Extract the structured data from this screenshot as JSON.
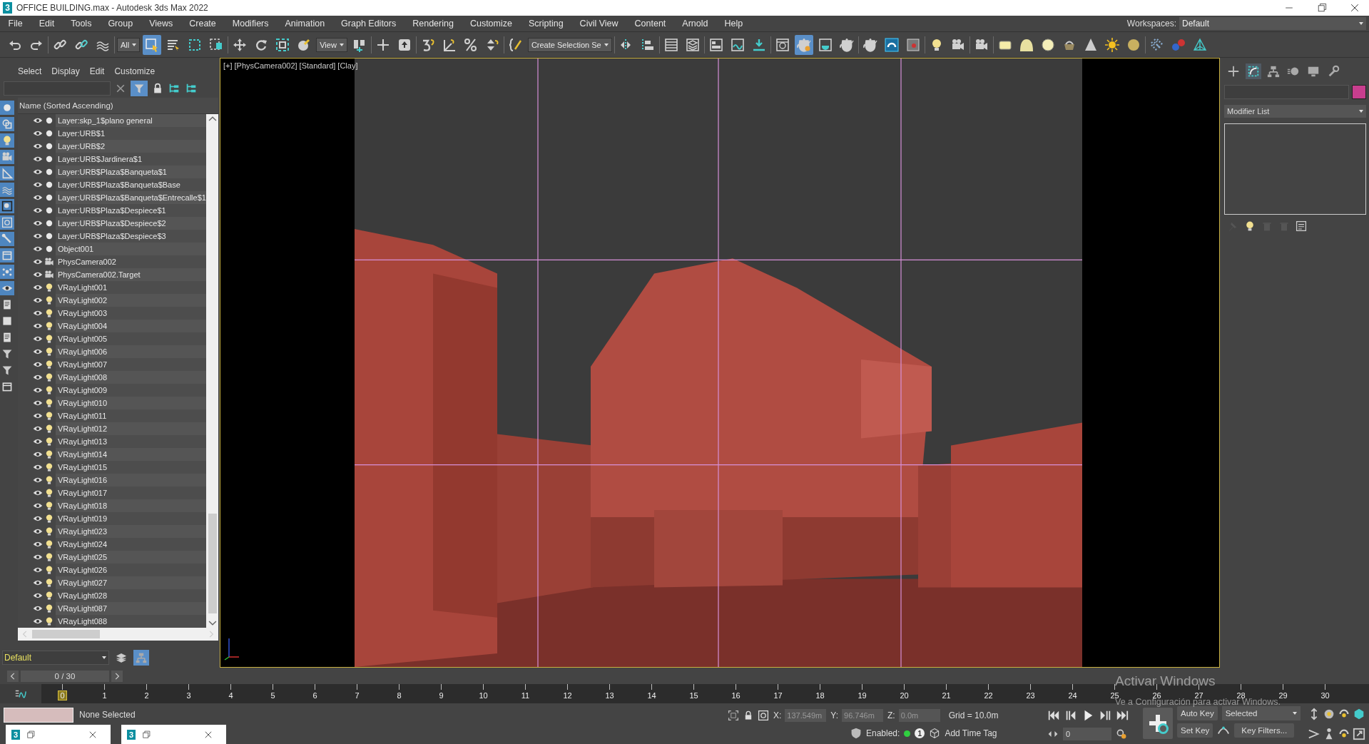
{
  "window": {
    "icon_label": "3",
    "title": "OFFICE BUILDING.max - Autodesk 3ds Max 2022"
  },
  "menu": [
    "File",
    "Edit",
    "Tools",
    "Group",
    "Views",
    "Create",
    "Modifiers",
    "Animation",
    "Graph Editors",
    "Rendering",
    "Customize",
    "Scripting",
    "Civil View",
    "Content",
    "Arnold",
    "Help"
  ],
  "workspaces": {
    "label": "Workspaces:",
    "value": "Default"
  },
  "toolbar": {
    "groups": [
      {
        "items": [
          {
            "kind": "icon",
            "selected": false
          },
          {
            "kind": "icon",
            "selected": false
          }
        ]
      },
      {
        "items": [
          {
            "kind": "icon",
            "selected": false
          },
          {
            "kind": "icon",
            "selected": false
          },
          {
            "kind": "icon",
            "selected": false
          }
        ]
      },
      {
        "items": [
          {
            "kind": "dropdown",
            "value": "All"
          },
          {
            "kind": "icon",
            "selected": true
          },
          {
            "kind": "icon",
            "selected": false
          },
          {
            "kind": "icon",
            "selected": false
          },
          {
            "kind": "icon",
            "selected": false
          }
        ]
      },
      {
        "items": [
          {
            "kind": "icon",
            "selected": false
          },
          {
            "kind": "icon",
            "selected": false
          },
          {
            "kind": "icon",
            "selected": false
          },
          {
            "kind": "icon",
            "selected": false
          },
          {
            "kind": "dropdown",
            "value": "View"
          },
          {
            "kind": "icon",
            "selected": false
          }
        ]
      },
      {
        "items": [
          {
            "kind": "icon",
            "selected": false
          },
          {
            "kind": "icon",
            "selected": false
          }
        ]
      },
      {
        "items": [
          {
            "kind": "icon",
            "selected": false
          },
          {
            "kind": "icon",
            "selected": false
          },
          {
            "kind": "icon",
            "selected": false
          },
          {
            "kind": "icon",
            "selected": false
          }
        ]
      },
      {
        "items": [
          {
            "kind": "icon",
            "selected": false
          },
          {
            "kind": "dropdown",
            "value": "Create Selection Se"
          }
        ]
      },
      {
        "items": [
          {
            "kind": "icon",
            "selected": false
          },
          {
            "kind": "icon",
            "selected": false
          }
        ]
      },
      {
        "items": [
          {
            "kind": "icon",
            "selected": false
          },
          {
            "kind": "icon",
            "selected": false
          }
        ]
      },
      {
        "items": [
          {
            "kind": "icon",
            "selected": false
          },
          {
            "kind": "icon",
            "selected": false
          },
          {
            "kind": "icon",
            "selected": false
          }
        ]
      },
      {
        "items": [
          {
            "kind": "icon",
            "selected": false
          },
          {
            "kind": "icon",
            "selected": true
          },
          {
            "kind": "icon",
            "selected": false
          },
          {
            "kind": "icon",
            "selected": false
          }
        ]
      },
      {
        "items": [
          {
            "kind": "icon",
            "selected": false
          },
          {
            "kind": "icon",
            "selected": false
          },
          {
            "kind": "icon",
            "selected": false
          }
        ]
      },
      {
        "items": [
          {
            "kind": "icon",
            "selected": false
          },
          {
            "kind": "icon",
            "selected": false
          }
        ]
      },
      {
        "items": [
          {
            "kind": "icon",
            "selected": false
          }
        ]
      },
      {
        "items": [
          {
            "kind": "icon",
            "selected": false
          },
          {
            "kind": "icon",
            "selected": false
          },
          {
            "kind": "icon",
            "selected": false
          },
          {
            "kind": "icon",
            "selected": false
          },
          {
            "kind": "icon",
            "selected": false
          },
          {
            "kind": "icon",
            "selected": false
          },
          {
            "kind": "icon",
            "selected": false
          }
        ]
      },
      {
        "items": [
          {
            "kind": "icon",
            "selected": false
          },
          {
            "kind": "icon",
            "selected": false
          },
          {
            "kind": "icon",
            "selected": false
          }
        ]
      }
    ]
  },
  "left_strip": [
    {
      "selected": true
    },
    {
      "selected": true
    },
    {
      "selected": true
    },
    {
      "selected": true
    },
    {
      "selected": true
    },
    {
      "selected": true
    },
    {
      "selected": true
    },
    {
      "selected": true
    },
    {
      "selected": true
    },
    {
      "selected": true
    },
    {
      "selected": true
    },
    {
      "selected": true
    },
    {
      "selected": false
    },
    {
      "selected": false
    },
    {
      "selected": false
    },
    {
      "selected": false
    },
    {
      "selected": false
    },
    {
      "selected": false
    }
  ],
  "scene_explorer": {
    "menu": [
      "Select",
      "Display",
      "Edit",
      "Customize"
    ],
    "column": "Name (Sorted Ascending)",
    "rows": [
      {
        "kind": "layer",
        "name": "Layer:skp_1$plano general"
      },
      {
        "kind": "layer",
        "name": "Layer:URB$1"
      },
      {
        "kind": "layer",
        "name": "Layer:URB$2"
      },
      {
        "kind": "layer",
        "name": "Layer:URB$Jardinera$1"
      },
      {
        "kind": "layer",
        "name": "Layer:URB$Plaza$Banqueta$1"
      },
      {
        "kind": "layer",
        "name": "Layer:URB$Plaza$Banqueta$Base"
      },
      {
        "kind": "layer",
        "name": "Layer:URB$Plaza$Banqueta$Entrecalle$1"
      },
      {
        "kind": "layer",
        "name": "Layer:URB$Plaza$Despiece$1"
      },
      {
        "kind": "layer",
        "name": "Layer:URB$Plaza$Despiece$2"
      },
      {
        "kind": "layer",
        "name": "Layer:URB$Plaza$Despiece$3"
      },
      {
        "kind": "layer",
        "name": "Object001"
      },
      {
        "kind": "camera",
        "name": "PhysCamera002"
      },
      {
        "kind": "camera",
        "name": "PhysCamera002.Target"
      },
      {
        "kind": "light",
        "name": "VRayLight001"
      },
      {
        "kind": "light",
        "name": "VRayLight002"
      },
      {
        "kind": "light",
        "name": "VRayLight003"
      },
      {
        "kind": "light",
        "name": "VRayLight004"
      },
      {
        "kind": "light",
        "name": "VRayLight005"
      },
      {
        "kind": "light",
        "name": "VRayLight006"
      },
      {
        "kind": "light",
        "name": "VRayLight007"
      },
      {
        "kind": "light",
        "name": "VRayLight008"
      },
      {
        "kind": "light",
        "name": "VRayLight009"
      },
      {
        "kind": "light",
        "name": "VRayLight010"
      },
      {
        "kind": "light",
        "name": "VRayLight011"
      },
      {
        "kind": "light",
        "name": "VRayLight012"
      },
      {
        "kind": "light",
        "name": "VRayLight013"
      },
      {
        "kind": "light",
        "name": "VRayLight014"
      },
      {
        "kind": "light",
        "name": "VRayLight015"
      },
      {
        "kind": "light",
        "name": "VRayLight016"
      },
      {
        "kind": "light",
        "name": "VRayLight017"
      },
      {
        "kind": "light",
        "name": "VRayLight018"
      },
      {
        "kind": "light",
        "name": "VRayLight019"
      },
      {
        "kind": "light",
        "name": "VRayLight023"
      },
      {
        "kind": "light",
        "name": "VRayLight024"
      },
      {
        "kind": "light",
        "name": "VRayLight025"
      },
      {
        "kind": "light",
        "name": "VRayLight026"
      },
      {
        "kind": "light",
        "name": "VRayLight027"
      },
      {
        "kind": "light",
        "name": "VRayLight028"
      },
      {
        "kind": "light",
        "name": "VRayLight087"
      },
      {
        "kind": "light",
        "name": "VRayLight088"
      }
    ]
  },
  "layer": {
    "value": "Default"
  },
  "viewport": {
    "labels": [
      "[+]",
      "[PhysCamera002]",
      "[Standard]",
      "[Clay]"
    ]
  },
  "command_panel": {
    "tabs": [
      {
        "selected": false
      },
      {
        "selected": true
      },
      {
        "selected": false
      },
      {
        "selected": false
      },
      {
        "selected": false
      },
      {
        "selected": false
      }
    ],
    "modifier_list": "Modifier List"
  },
  "time_slider": {
    "value": "0 / 30"
  },
  "trackbar": {
    "ticks": [
      {
        "label": "0",
        "selected": true
      },
      {
        "label": "1",
        "selected": false
      },
      {
        "label": "2",
        "selected": false
      },
      {
        "label": "3",
        "selected": false
      },
      {
        "label": "4",
        "selected": false
      },
      {
        "label": "5",
        "selected": false
      },
      {
        "label": "6",
        "selected": false
      },
      {
        "label": "7",
        "selected": false
      },
      {
        "label": "8",
        "selected": false
      },
      {
        "label": "9",
        "selected": false
      },
      {
        "label": "10",
        "selected": false
      },
      {
        "label": "11",
        "selected": false
      },
      {
        "label": "12",
        "selected": false
      },
      {
        "label": "13",
        "selected": false
      },
      {
        "label": "14",
        "selected": false
      },
      {
        "label": "15",
        "selected": false
      },
      {
        "label": "16",
        "selected": false
      },
      {
        "label": "17",
        "selected": false
      },
      {
        "label": "18",
        "selected": false
      },
      {
        "label": "19",
        "selected": false
      },
      {
        "label": "20",
        "selected": false
      },
      {
        "label": "21",
        "selected": false
      },
      {
        "label": "22",
        "selected": false
      },
      {
        "label": "23",
        "selected": false
      },
      {
        "label": "24",
        "selected": false
      },
      {
        "label": "25",
        "selected": false
      },
      {
        "label": "26",
        "selected": false
      },
      {
        "label": "27",
        "selected": false
      },
      {
        "label": "28",
        "selected": false
      },
      {
        "label": "29",
        "selected": false
      },
      {
        "label": "30",
        "selected": false
      }
    ]
  },
  "status": {
    "selection": "None Selected",
    "minimized_windows": [
      {
        "icon_label": "3"
      },
      {
        "icon_label": "3"
      }
    ],
    "coords": [
      {
        "label": "X:",
        "value": "137.549m",
        "disabled": true
      },
      {
        "label": "Y:",
        "value": "96.746m",
        "disabled": true
      },
      {
        "label": "Z:",
        "value": "0.0m",
        "disabled": true
      }
    ],
    "grid": "Grid = 10.0m",
    "enabled_label": "Enabled:",
    "enabled": true,
    "badge": "1",
    "add_time_tag": "Add Time Tag",
    "frame": "0",
    "auto_key": "Auto Key",
    "key_mode": "Selected",
    "set_key": "Set Key",
    "key_filters": "Key Filters..."
  },
  "os_overlay": {
    "title": "Activar Windows",
    "message": "Ve a Configuración para activar Windows."
  }
}
